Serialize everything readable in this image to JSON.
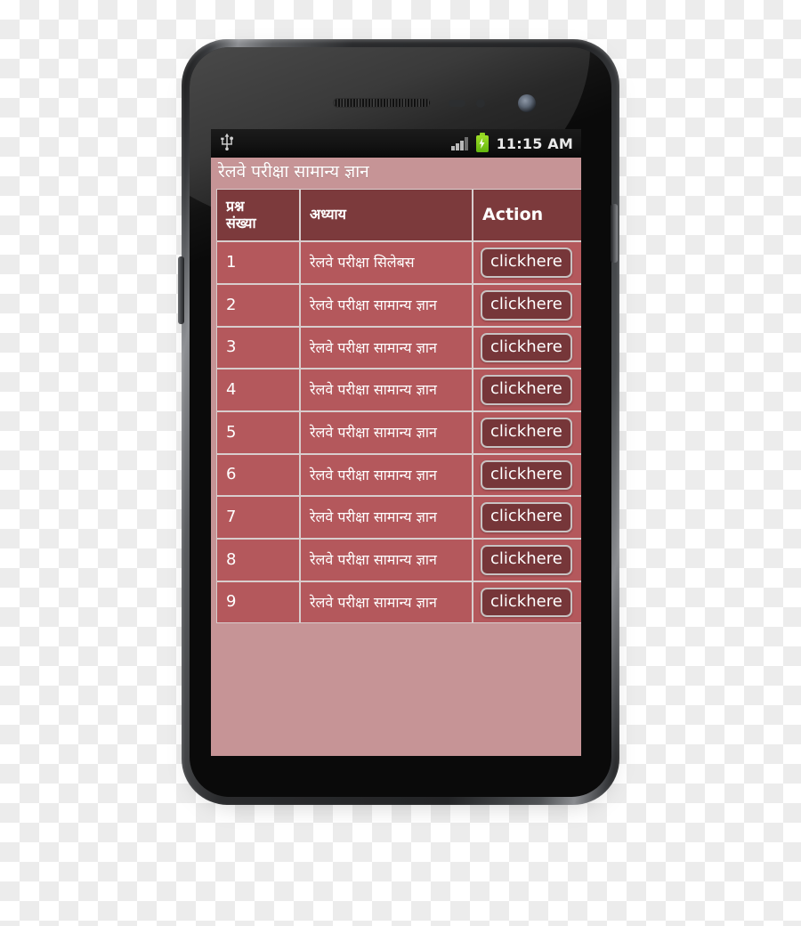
{
  "device": {
    "type": "smartphone",
    "hardware": {
      "earpiece": "earpiece-speaker",
      "front_camera": "front-camera",
      "proximity_sensor": "proximity-sensor",
      "volume_button": "volume-rocker",
      "power_button": "power-button"
    }
  },
  "status_bar": {
    "usb_icon": "usb-icon",
    "signal_icon": "signal-bars-icon",
    "signal_bars_filled": 3,
    "signal_bars_total": 4,
    "battery_icon": "battery-charging-icon",
    "time": "11:15 AM"
  },
  "app": {
    "title": "रेलवे परीक्षा सामान्य ज्ञान",
    "table": {
      "columns": [
        "प्रश्न संख्या",
        "अध्याय",
        "Action"
      ],
      "column_keys": [
        "number",
        "chapter",
        "action"
      ],
      "header_num_line1": "प्रश्न",
      "header_num_line2": "संख्या",
      "header_chapter": "अध्याय",
      "header_action": "Action",
      "rows": [
        {
          "number": "1",
          "chapter": "रेलवे परीक्षा सिलेबस",
          "action_label": "clickhere"
        },
        {
          "number": "2",
          "chapter": "रेलवे परीक्षा सामान्य ज्ञान",
          "action_label": "clickhere"
        },
        {
          "number": "3",
          "chapter": "रेलवे परीक्षा सामान्य ज्ञान",
          "action_label": "clickhere"
        },
        {
          "number": "4",
          "chapter": "रेलवे परीक्षा सामान्य ज्ञान",
          "action_label": "clickhere"
        },
        {
          "number": "5",
          "chapter": "रेलवे परीक्षा सामान्य ज्ञान",
          "action_label": "clickhere"
        },
        {
          "number": "6",
          "chapter": "रेलवे परीक्षा सामान्य ज्ञान",
          "action_label": "clickhere"
        },
        {
          "number": "7",
          "chapter": "रेलवे परीक्षा सामान्य ज्ञान",
          "action_label": "clickhere"
        },
        {
          "number": "8",
          "chapter": "रेलवे परीक्षा सामान्य ज्ञान",
          "action_label": "clickhere"
        },
        {
          "number": "9",
          "chapter": "रेलवे परीक्षा सामान्य ज्ञान",
          "action_label": "clickhere"
        }
      ]
    }
  },
  "colors": {
    "app_background": "#c69496",
    "table_header_cell": "#7c3a3c",
    "table_row_cell": "#b4585c",
    "table_border": "#d8cdcd",
    "button_face": "#763639",
    "button_border": "#c8c2c2",
    "text": "#ffffff",
    "status_bar": "#131313",
    "battery_green": "#8ed320"
  }
}
